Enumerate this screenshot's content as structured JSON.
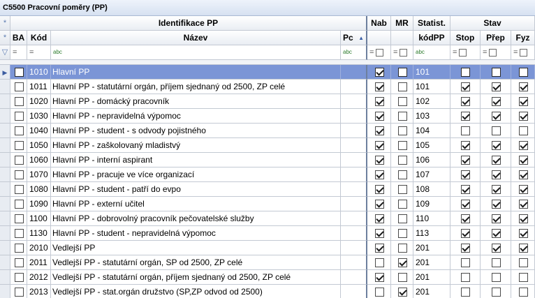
{
  "window": {
    "title": "C5500 Pracovní poměry (PP)"
  },
  "header": {
    "group_identifikace": "Identifikace PP",
    "group_stav": "Stav",
    "col_ba": "BA",
    "col_kod": "Kód",
    "col_nazev": "Název",
    "col_pc": "Pc",
    "col_nab": "Nab",
    "col_mr": "MR",
    "col_statist_top": "Statist.",
    "col_statist_bottom": "kódPP",
    "col_stop": "Stop",
    "col_prep": "Přep",
    "col_fyz": "Fyz",
    "indicator_star": "*"
  },
  "filter": {
    "eq": "=",
    "abc": "abc"
  },
  "icons": {
    "row_pointer": "row-pointer-icon",
    "filter_funnel": "filter-funnel-icon",
    "sort": "sort-ascending-icon"
  },
  "colors": {
    "selected_row": "#7b95d6",
    "header_sep": "#6d7f9e"
  },
  "rows": [
    {
      "kod": "1010",
      "nazev": "Hlavní PP",
      "nab": true,
      "mr": false,
      "stat": "101",
      "stop": false,
      "prep": false,
      "fyz": false,
      "selected": true
    },
    {
      "kod": "1011",
      "nazev": "Hlavní PP - statutární orgán, příjem sjednaný od 2500, ZP celé",
      "nab": true,
      "mr": false,
      "stat": "101",
      "stop": true,
      "prep": true,
      "fyz": true
    },
    {
      "kod": "1020",
      "nazev": "Hlavní PP - domácký pracovník",
      "nab": true,
      "mr": false,
      "stat": "102",
      "stop": true,
      "prep": true,
      "fyz": true
    },
    {
      "kod": "1030",
      "nazev": "Hlavní PP - nepravidelná výpomoc",
      "nab": true,
      "mr": false,
      "stat": "103",
      "stop": true,
      "prep": true,
      "fyz": true
    },
    {
      "kod": "1040",
      "nazev": "Hlavní PP - student - s odvody pojistného",
      "nab": true,
      "mr": false,
      "stat": "104",
      "stop": false,
      "prep": false,
      "fyz": false
    },
    {
      "kod": "1050",
      "nazev": "Hlavní PP - zaškolovaný mladistvý",
      "nab": true,
      "mr": false,
      "stat": "105",
      "stop": true,
      "prep": true,
      "fyz": true
    },
    {
      "kod": "1060",
      "nazev": "Hlavní PP - interní aspirant",
      "nab": true,
      "mr": false,
      "stat": "106",
      "stop": true,
      "prep": true,
      "fyz": true
    },
    {
      "kod": "1070",
      "nazev": "Hlavní PP - pracuje ve více organizací",
      "nab": true,
      "mr": false,
      "stat": "107",
      "stop": true,
      "prep": true,
      "fyz": true
    },
    {
      "kod": "1080",
      "nazev": "Hlavní PP - student - patří do evpo",
      "nab": true,
      "mr": false,
      "stat": "108",
      "stop": true,
      "prep": true,
      "fyz": true
    },
    {
      "kod": "1090",
      "nazev": "Hlavní PP - externí učitel",
      "nab": true,
      "mr": false,
      "stat": "109",
      "stop": true,
      "prep": true,
      "fyz": true
    },
    {
      "kod": "1100",
      "nazev": "Hlavní PP - dobrovolný pracovník pečovatelské služby",
      "nab": true,
      "mr": false,
      "stat": "110",
      "stop": true,
      "prep": true,
      "fyz": true
    },
    {
      "kod": "1130",
      "nazev": "Hlavní PP - student - nepravidelná výpomoc",
      "nab": true,
      "mr": false,
      "stat": "113",
      "stop": true,
      "prep": true,
      "fyz": true
    },
    {
      "kod": "2010",
      "nazev": "Vedlejší PP",
      "nab": true,
      "mr": false,
      "stat": "201",
      "stop": true,
      "prep": true,
      "fyz": true
    },
    {
      "kod": "2011",
      "nazev": "Vedlejší PP - statutární orgán, SP od 2500, ZP celé",
      "nab": false,
      "mr": true,
      "stat": "201",
      "stop": false,
      "prep": false,
      "fyz": false
    },
    {
      "kod": "2012",
      "nazev": "Vedlejší PP - statutární orgán, příjem sjednaný od 2500, ZP celé",
      "nab": true,
      "mr": false,
      "stat": "201",
      "stop": false,
      "prep": false,
      "fyz": false
    },
    {
      "kod": "2013",
      "nazev": "Vedlejší PP - stat.orgán družstvo (SP,ZP  odvod od 2500)",
      "nab": false,
      "mr": true,
      "stat": "201",
      "stop": false,
      "prep": false,
      "fyz": false
    }
  ]
}
